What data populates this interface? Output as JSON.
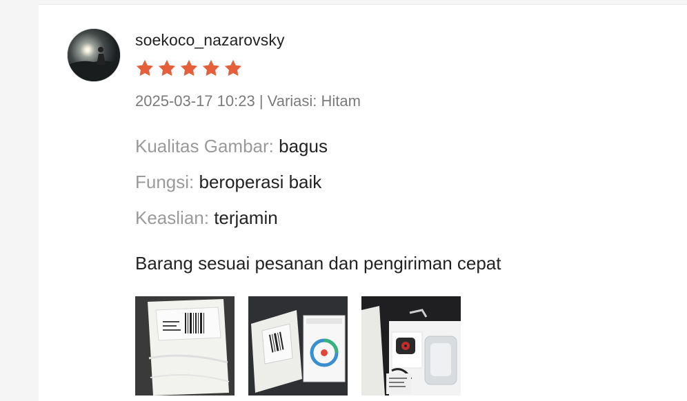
{
  "review": {
    "username": "soekoco_nazarovsky",
    "rating": 5,
    "rating_max": 5,
    "star_color": "#e45f3a",
    "date": "2025-03-17 10:23",
    "separator": "|",
    "variation_label": "Variasi:",
    "variation_value": "Hitam",
    "attributes": [
      {
        "key": "Kualitas Gambar:",
        "value": "bagus"
      },
      {
        "key": "Fungsi:",
        "value": "beroperasi baik"
      },
      {
        "key": "Keaslian:",
        "value": "terjamin"
      }
    ],
    "comment": "Barang sesuai pesanan dan pengiriman cepat",
    "photos": [
      {
        "icon": "photo-white-package"
      },
      {
        "icon": "photo-package-and-box"
      },
      {
        "icon": "photo-unboxed-device"
      }
    ]
  }
}
